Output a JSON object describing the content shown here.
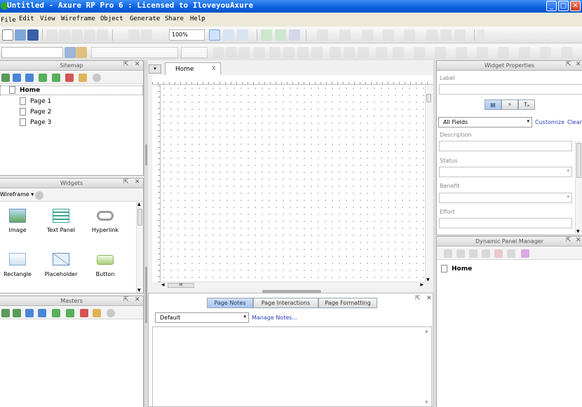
{
  "window": {
    "title": "Untitled - Axure RP Pro 6 : Licensed to IloveyouAxure",
    "minimize_glyph": "_",
    "maximize_glyph": "□",
    "close_glyph": "✕"
  },
  "menu": [
    "File",
    "Edit",
    "View",
    "Wireframe",
    "Object",
    "Generate",
    "Share",
    "Help"
  ],
  "toolbar": {
    "zoom": "100%"
  },
  "sitemap": {
    "title": "Sitemap",
    "root": "Home",
    "pages": [
      "Page 1",
      "Page 2",
      "Page 3"
    ]
  },
  "widgets": {
    "title": "Widgets",
    "library": "Wireframe",
    "items": [
      "Image",
      "Text Panel",
      "Hyperlink",
      "Rectangle",
      "Placeholder",
      "Button"
    ]
  },
  "masters": {
    "title": "Masters"
  },
  "canvas": {
    "tab_label": "Home",
    "tab_close": "X",
    "hscroll_thumb": "III"
  },
  "notes": {
    "tabs": [
      "Page Notes",
      "Page Interactions",
      "Page Formatting"
    ],
    "dropdown": "Default",
    "manage_link": "Manage Notes..."
  },
  "properties": {
    "title": "Widget Properties",
    "label_field": "Label",
    "fields_dropdown": "All Fields",
    "customize": "Customize",
    "clear": "Clear",
    "fields": [
      "Description",
      "Status",
      "Benefit",
      "Effort"
    ],
    "tab_glyphs": [
      "▤",
      "⚡",
      "Tₐ"
    ]
  },
  "dynamic_panel": {
    "title": "Dynamic Panel Manager",
    "root": "Home"
  },
  "colors": {
    "titlebar": "#0a5fe0",
    "link": "#2b3fbf",
    "tab_active": "#a9c6ee"
  }
}
